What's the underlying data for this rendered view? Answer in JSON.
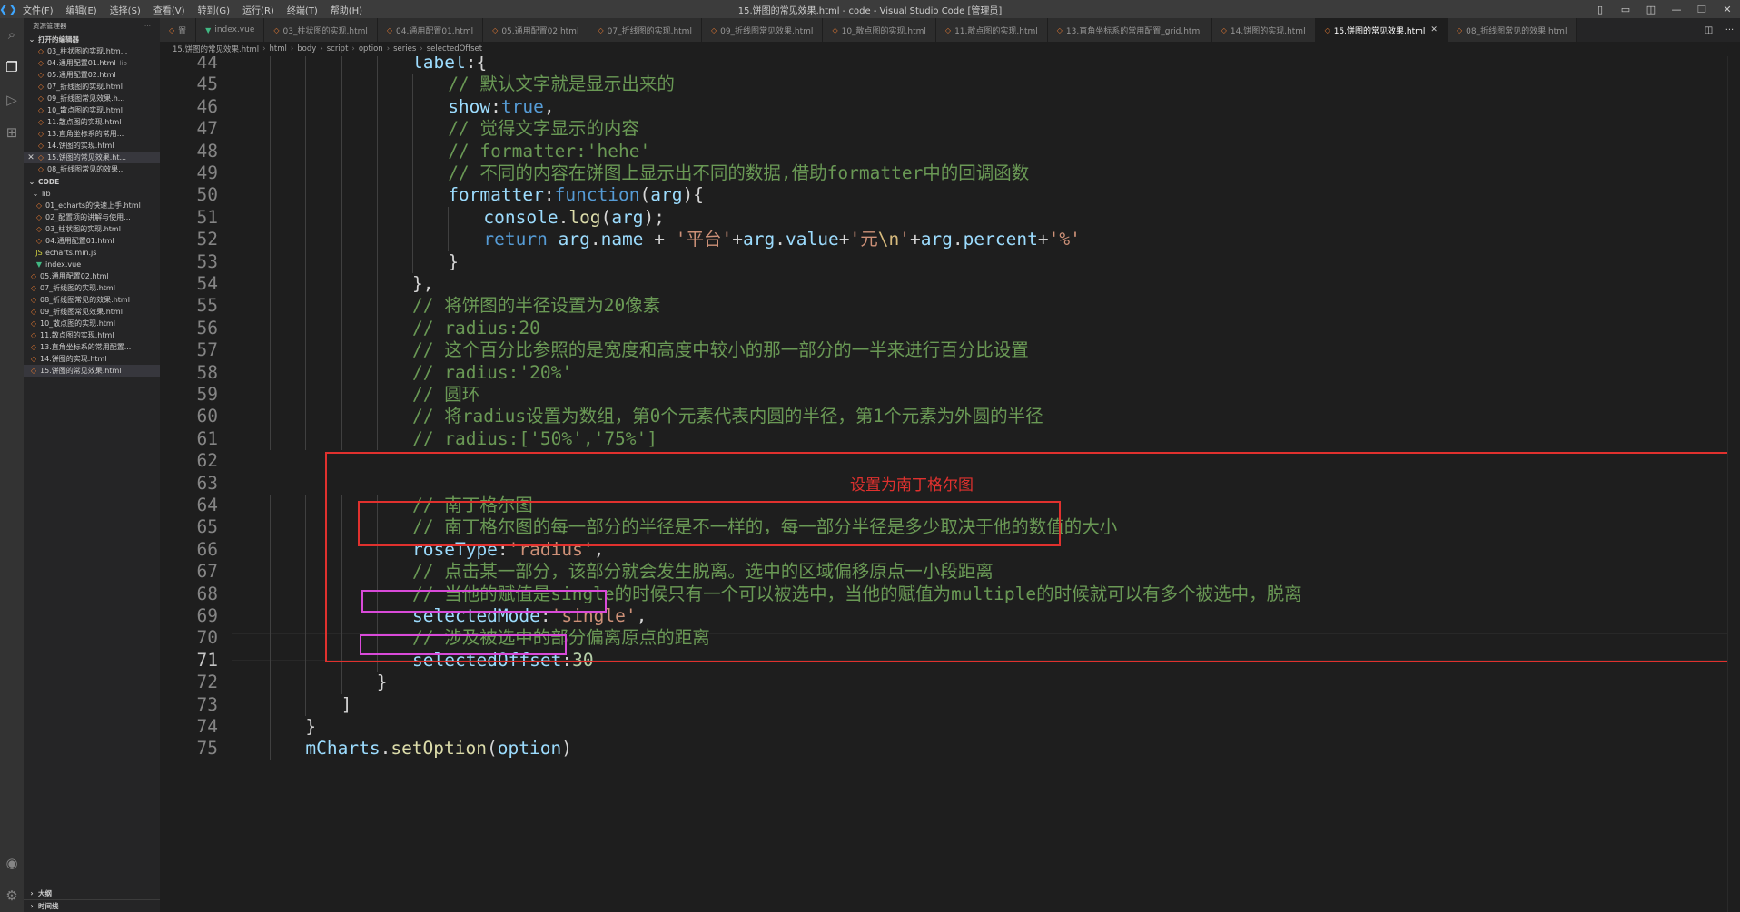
{
  "titlebar": {
    "title": "15.饼图的常见效果.html - code - Visual Studio Code [管理员]",
    "menus": [
      "文件(F)",
      "编辑(E)",
      "选择(S)",
      "查看(V)",
      "转到(G)",
      "运行(R)",
      "终端(T)",
      "帮助(H)"
    ]
  },
  "sidebar": {
    "header": "资源管理器",
    "more": "···",
    "open_editors_title": "打开的编辑器",
    "open_editors": [
      {
        "label": "03_柱状图的实现.htm...",
        "type": "html"
      },
      {
        "label": "04.通用配置01.html",
        "type": "html",
        "hint": "lib"
      },
      {
        "label": "05.通用配置02.html",
        "type": "html"
      },
      {
        "label": "07_折线图的实现.html",
        "type": "html"
      },
      {
        "label": "09_折线图常见效果.h...",
        "type": "html"
      },
      {
        "label": "10_散点图的实现.html",
        "type": "html"
      },
      {
        "label": "11.散点图的实现.html",
        "type": "html"
      },
      {
        "label": "13.直角坐标系的常用...",
        "type": "html"
      },
      {
        "label": "14.饼图的实现.html",
        "type": "html"
      },
      {
        "label": "15.饼图的常见效果.ht...",
        "type": "html",
        "active": true
      },
      {
        "label": "08_折线图常见的效果...",
        "type": "html"
      }
    ],
    "folder_title": "CODE",
    "lib_folder": "lib",
    "lib_files": [
      {
        "label": "01_echarts的快速上手.html",
        "type": "html"
      },
      {
        "label": "02_配置项的讲解与使用...",
        "type": "html"
      },
      {
        "label": "03_柱状图的实现.html",
        "type": "html"
      },
      {
        "label": "04.通用配置01.html",
        "type": "html"
      },
      {
        "label": "echarts.min.js",
        "type": "js"
      },
      {
        "label": "index.vue",
        "type": "vue"
      }
    ],
    "root_files": [
      {
        "label": "05.通用配置02.html",
        "type": "html"
      },
      {
        "label": "07_折线图的实现.html",
        "type": "html"
      },
      {
        "label": "08_折线图常见的效果.html",
        "type": "html"
      },
      {
        "label": "09_折线图常见效果.html",
        "type": "html"
      },
      {
        "label": "10_散点图的实现.html",
        "type": "html"
      },
      {
        "label": "11.散点图的实现.html",
        "type": "html"
      },
      {
        "label": "13.直角坐标系的常用配置...",
        "type": "html"
      },
      {
        "label": "14.饼图的实现.html",
        "type": "html"
      },
      {
        "label": "15.饼图的常见效果.html",
        "type": "html",
        "active": true
      }
    ],
    "outline_title": "大纲",
    "timeline_title": "时间线"
  },
  "tabs": [
    {
      "label": "置",
      "type": "html"
    },
    {
      "label": "index.vue",
      "type": "vue"
    },
    {
      "label": "03_柱状图的实现.html",
      "type": "html"
    },
    {
      "label": "04.通用配置01.html",
      "type": "html"
    },
    {
      "label": "05.通用配置02.html",
      "type": "html"
    },
    {
      "label": "07_折线图的实现.html",
      "type": "html"
    },
    {
      "label": "09_折线图常见效果.html",
      "type": "html"
    },
    {
      "label": "10_散点图的实现.html",
      "type": "html"
    },
    {
      "label": "11.散点图的实现.html",
      "type": "html"
    },
    {
      "label": "13.直角坐标系的常用配置_grid.html",
      "type": "html"
    },
    {
      "label": "14.饼图的实现.html",
      "type": "html"
    },
    {
      "label": "15.饼图的常见效果.html",
      "type": "html",
      "active": true
    },
    {
      "label": "08_折线图常见的效果.html",
      "type": "html"
    }
  ],
  "breadcrumb": [
    "15.饼图的常见效果.html",
    "html",
    "body",
    "script",
    "option",
    "series",
    "selectedOffset"
  ],
  "editor": {
    "current_line": 71,
    "lines": [
      {
        "n": 44,
        "indent": 5,
        "tokens": [
          [
            "pr",
            "label"
          ],
          [
            "pl",
            ":{"
          ]
        ]
      },
      {
        "n": 45,
        "indent": 6,
        "tokens": [
          [
            "cm",
            "// 默认文字就是显示出来的"
          ]
        ]
      },
      {
        "n": 46,
        "indent": 6,
        "tokens": [
          [
            "pr",
            "show"
          ],
          [
            "pl",
            ":"
          ],
          [
            "kw",
            "true"
          ],
          [
            "pl",
            ","
          ]
        ]
      },
      {
        "n": 47,
        "indent": 6,
        "tokens": [
          [
            "cm",
            "// 觉得文字显示的内容"
          ]
        ]
      },
      {
        "n": 48,
        "indent": 6,
        "tokens": [
          [
            "cm",
            "// formatter:'hehe'"
          ]
        ]
      },
      {
        "n": 49,
        "indent": 6,
        "tokens": [
          [
            "cm",
            "// 不同的内容在饼图上显示出不同的数据,借助formatter中的回调函数"
          ]
        ]
      },
      {
        "n": 50,
        "indent": 6,
        "tokens": [
          [
            "pr",
            "formatter"
          ],
          [
            "pl",
            ":"
          ],
          [
            "kw",
            "function"
          ],
          [
            "pl",
            "("
          ],
          [
            "pr",
            "arg"
          ],
          [
            "pl",
            "){"
          ]
        ]
      },
      {
        "n": 51,
        "indent": 7,
        "tokens": [
          [
            "pr",
            "console"
          ],
          [
            "pl",
            "."
          ],
          [
            "fn",
            "log"
          ],
          [
            "pl",
            "("
          ],
          [
            "pr",
            "arg"
          ],
          [
            "pl",
            ");"
          ]
        ]
      },
      {
        "n": 52,
        "indent": 7,
        "tokens": [
          [
            "kw",
            "return"
          ],
          [
            "pl",
            " "
          ],
          [
            "pr",
            "arg"
          ],
          [
            "pl",
            "."
          ],
          [
            "pr",
            "name"
          ],
          [
            "pl",
            " + "
          ],
          [
            "st",
            "'平台'"
          ],
          [
            "pl",
            "+"
          ],
          [
            "pr",
            "arg"
          ],
          [
            "pl",
            "."
          ],
          [
            "pr",
            "value"
          ],
          [
            "pl",
            "+"
          ],
          [
            "st",
            "'元"
          ],
          [
            "esc",
            "\\n"
          ],
          [
            "st",
            "'"
          ],
          [
            "pl",
            "+"
          ],
          [
            "pr",
            "arg"
          ],
          [
            "pl",
            "."
          ],
          [
            "pr",
            "percent"
          ],
          [
            "pl",
            "+"
          ],
          [
            "st",
            "'%'"
          ]
        ]
      },
      {
        "n": 53,
        "indent": 6,
        "tokens": [
          [
            "pl",
            "}"
          ]
        ]
      },
      {
        "n": 54,
        "indent": 5,
        "tokens": [
          [
            "pl",
            "},"
          ]
        ]
      },
      {
        "n": 55,
        "indent": 5,
        "tokens": [
          [
            "cm",
            "// 将饼图的半径设置为20像素"
          ]
        ]
      },
      {
        "n": 56,
        "indent": 5,
        "tokens": [
          [
            "cm",
            "// radius:20"
          ]
        ]
      },
      {
        "n": 57,
        "indent": 5,
        "tokens": [
          [
            "cm",
            "// 这个百分比参照的是宽度和高度中较小的那一部分的一半来进行百分比设置"
          ]
        ]
      },
      {
        "n": 58,
        "indent": 5,
        "tokens": [
          [
            "cm",
            "// radius:'20%'"
          ]
        ]
      },
      {
        "n": 59,
        "indent": 5,
        "tokens": [
          [
            "cm",
            "// 圆环"
          ]
        ]
      },
      {
        "n": 60,
        "indent": 5,
        "tokens": [
          [
            "cm",
            "// 将radius设置为数组，第0个元素代表内圆的半径，第1个元素为外圆的半径"
          ]
        ]
      },
      {
        "n": 61,
        "indent": 5,
        "tokens": [
          [
            "cm",
            "// radius:['50%','75%']"
          ]
        ]
      },
      {
        "n": 62,
        "indent": 0,
        "tokens": []
      },
      {
        "n": 63,
        "indent": 0,
        "tokens": []
      },
      {
        "n": 64,
        "indent": 5,
        "tokens": [
          [
            "cm",
            "// 南丁格尔图"
          ]
        ]
      },
      {
        "n": 65,
        "indent": 5,
        "tokens": [
          [
            "cm",
            "// 南丁格尔图的每一部分的半径是不一样的，每一部分半径是多少取决于他的数值的大小"
          ]
        ]
      },
      {
        "n": 66,
        "indent": 5,
        "tokens": [
          [
            "pr",
            "roseType"
          ],
          [
            "pl",
            ":"
          ],
          [
            "st",
            "'radius'"
          ],
          [
            "pl",
            ","
          ]
        ]
      },
      {
        "n": 67,
        "indent": 5,
        "tokens": [
          [
            "cm",
            "// 点击某一部分，该部分就会发生脱离。选中的区域偏移原点一小段距离"
          ]
        ]
      },
      {
        "n": 68,
        "indent": 5,
        "tokens": [
          [
            "cm",
            "// 当他的赋值是single的时候只有一个可以被选中，当他的赋值为multiple的时候就可以有多个被选中，脱离"
          ]
        ]
      },
      {
        "n": 69,
        "indent": 5,
        "tokens": [
          [
            "pr",
            "selectedMode"
          ],
          [
            "pl",
            ":"
          ],
          [
            "st",
            "'single'"
          ],
          [
            "pl",
            ","
          ]
        ]
      },
      {
        "n": 70,
        "indent": 5,
        "tokens": [
          [
            "cm",
            "// 涉及被选中的部分偏离原点的距离"
          ]
        ]
      },
      {
        "n": 71,
        "indent": 5,
        "tokens": [
          [
            "pr",
            "selectedOffset"
          ],
          [
            "pl",
            ":"
          ],
          [
            "nu",
            "30"
          ]
        ]
      },
      {
        "n": 72,
        "indent": 4,
        "tokens": [
          [
            "pl",
            "}"
          ]
        ]
      },
      {
        "n": 73,
        "indent": 3,
        "tokens": [
          [
            "pl",
            "]"
          ]
        ]
      },
      {
        "n": 74,
        "indent": 2,
        "tokens": [
          [
            "pl",
            "}"
          ]
        ]
      },
      {
        "n": 75,
        "indent": 2,
        "tokens": [
          [
            "pr",
            "mCharts"
          ],
          [
            "pl",
            "."
          ],
          [
            "fn",
            "setOption"
          ],
          [
            "pl",
            "("
          ],
          [
            "pr",
            "option"
          ],
          [
            "pl",
            ")"
          ]
        ]
      }
    ]
  },
  "annotation": {
    "text": "设置为南丁格尔图",
    "color": "#e0312e",
    "highlight_color": "#d94ad9"
  }
}
